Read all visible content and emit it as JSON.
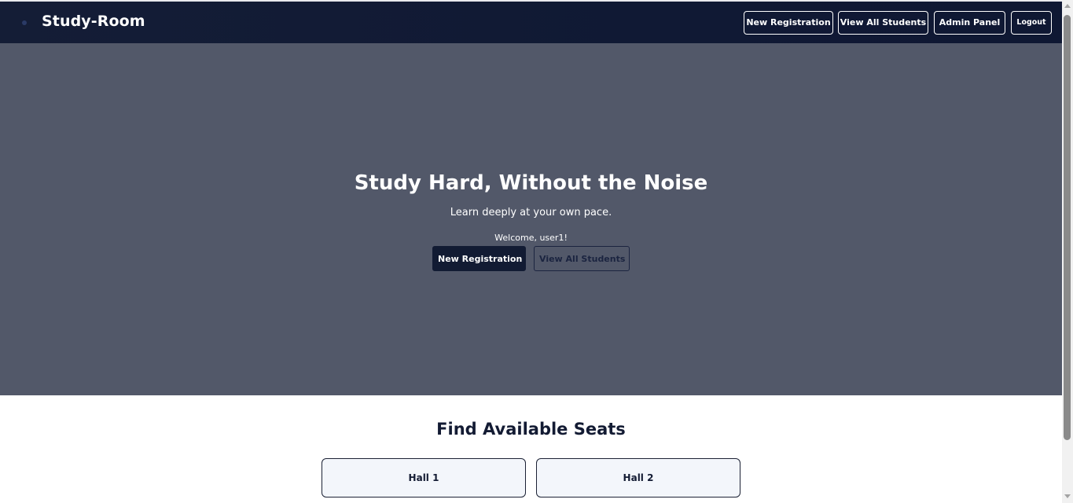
{
  "navbar": {
    "brand": "Study-Room",
    "links": {
      "new_registration": "New Registration",
      "view_all_students": "View All Students",
      "admin_panel": "Admin Panel",
      "logout": "Logout"
    }
  },
  "hero": {
    "title": "Study Hard, Without the Noise",
    "subtitle": "Learn deeply at your own pace.",
    "welcome": "Welcome, user1!",
    "primary_button": "New Registration",
    "secondary_button": "View All Students"
  },
  "seats": {
    "title": "Find Available Seats",
    "halls": [
      "Hall 1",
      "Hall 2"
    ]
  },
  "colors": {
    "navbar_bg": "#101934",
    "hero_bg": "#525869",
    "primary": "#121b33",
    "card_bg": "#f3f6fb"
  },
  "icons": {
    "logo": "logo-icon",
    "scroll_up": "scroll-up-arrow-icon",
    "scroll_down": "scroll-down-arrow-icon"
  }
}
